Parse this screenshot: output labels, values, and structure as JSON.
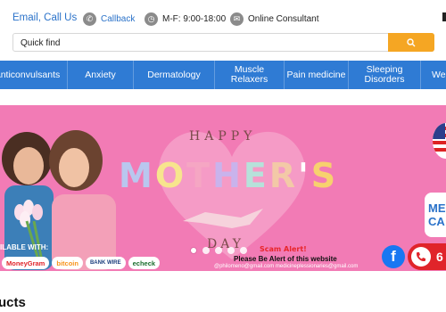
{
  "header": {
    "contact_links": {
      "email": "Email",
      "separator": ",",
      "call": "Call Us"
    },
    "callback": "Callback",
    "hours": "M-F: 9:00-18:00",
    "consultant": "Online Consultant"
  },
  "search": {
    "placeholder": "Quick find",
    "button_icon": "search-icon"
  },
  "nav": {
    "items": [
      {
        "label": "Anticonvulsants"
      },
      {
        "label": "Anxiety"
      },
      {
        "label": "Dermatology"
      },
      {
        "label": "Muscle Relaxers"
      },
      {
        "label": "Pain medicine"
      },
      {
        "label": "Sleeping Disorders"
      },
      {
        "label": "Wei"
      }
    ]
  },
  "banner": {
    "happy": "HAPPY",
    "mothers_letters": [
      "M",
      "O",
      "T",
      "H",
      "E",
      "R",
      "'",
      "S"
    ],
    "day": "DAY",
    "available_with": "ILABLE WITH:",
    "payments": [
      "MoneyGram",
      "bitcoin",
      "BANK WIRE",
      "echeck"
    ],
    "scam_alert": "Scam Alert!",
    "scam_warning": "Please Be Alert of this website",
    "emails": "@philomeno@gmail.com  medicineplessionaries@gmail.com",
    "side_badge": "ME CA",
    "phone_partial": "6",
    "slides": 5,
    "active_slide": 1
  },
  "colors": {
    "nav_bg": "#2f7bd4",
    "accent": "#f5a623",
    "banner_bg": "#f27bb5",
    "link": "#2a72c9"
  },
  "section": {
    "title": "ucts"
  }
}
